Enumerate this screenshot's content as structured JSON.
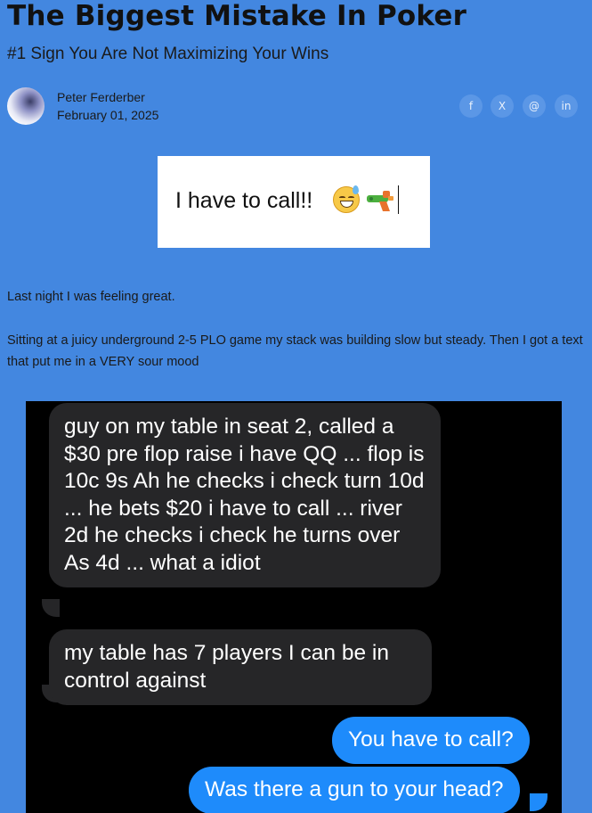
{
  "article": {
    "title": "The Biggest Mistake In Poker",
    "subtitle": "#1 Sign You Are Not Maximizing Your Wins",
    "author": "Peter Ferderber",
    "date": "February 01, 2025"
  },
  "share": {
    "facebook": "f",
    "x": "X",
    "threads": "@",
    "linkedin": "in"
  },
  "callout": {
    "text": "I have to call!!",
    "emojis": [
      "grinning-face-with-sweat-icon",
      "water-pistol-icon"
    ]
  },
  "body": {
    "para1": "Last night I was feeling great.",
    "para2": "Sitting at a juicy underground 2-5 PLO game my stack was building slow but steady. Then I got a text that put me in a VERY sour mood"
  },
  "chat": {
    "incoming": [
      "guy on my table in seat 2, called a $30 pre flop raise i have QQ ... flop is 10c 9s Ah he checks i check turn 10d ... he bets $20 i have to call ... river 2d he checks i check he turns over As 4d ... what a idiot",
      "my table has 7 players I can be in control against"
    ],
    "outgoing": [
      "You have to call?",
      "Was there a gun to your head?"
    ],
    "colors": {
      "incoming": "#262628",
      "outgoing": "#1e8bfb"
    }
  },
  "colors": {
    "page_background": "#4387e0",
    "accent": "#1e8bfb"
  }
}
